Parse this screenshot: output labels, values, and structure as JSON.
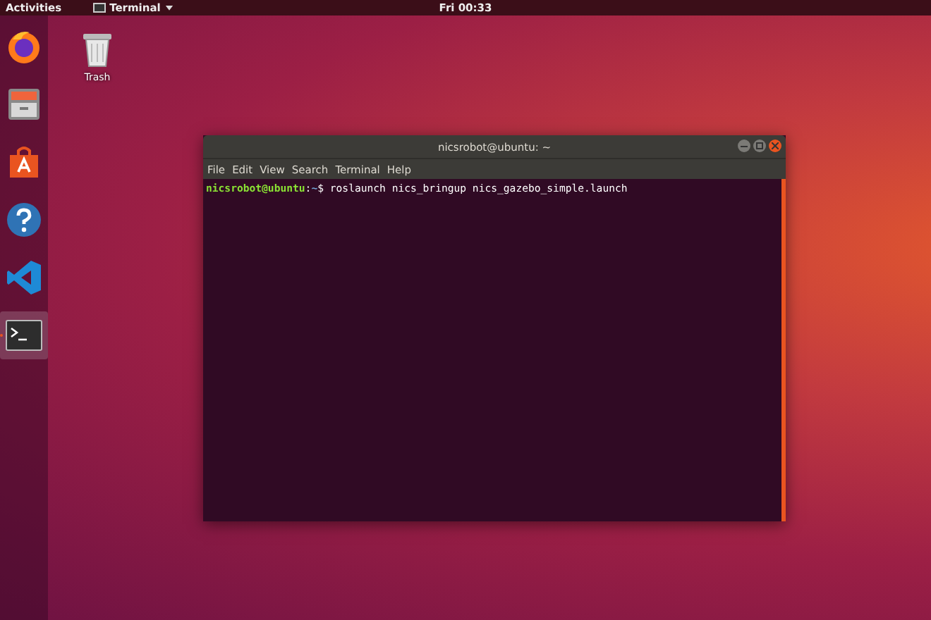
{
  "top_bar": {
    "activities": "Activities",
    "app_menu": {
      "label": "Terminal"
    },
    "clock": "Fri 00:33"
  },
  "dock": [
    {
      "kind": "firefox",
      "active": false
    },
    {
      "kind": "files",
      "active": false
    },
    {
      "kind": "store",
      "active": false
    },
    {
      "kind": "help",
      "active": false
    },
    {
      "kind": "code",
      "active": false
    },
    {
      "kind": "terminal",
      "active": true
    }
  ],
  "desktop_icons": [
    {
      "kind": "trash",
      "label": "Trash"
    }
  ],
  "terminal": {
    "title": "nicsrobot@ubuntu: ~",
    "menu": [
      "File",
      "Edit",
      "View",
      "Search",
      "Terminal",
      "Help"
    ],
    "lines": [
      {
        "user_host": "nicsrobot@ubuntu",
        "separator": ":",
        "path": "~",
        "command": "$ roslaunch nics_bringup nics_gazebo_simple.launch"
      }
    ]
  }
}
